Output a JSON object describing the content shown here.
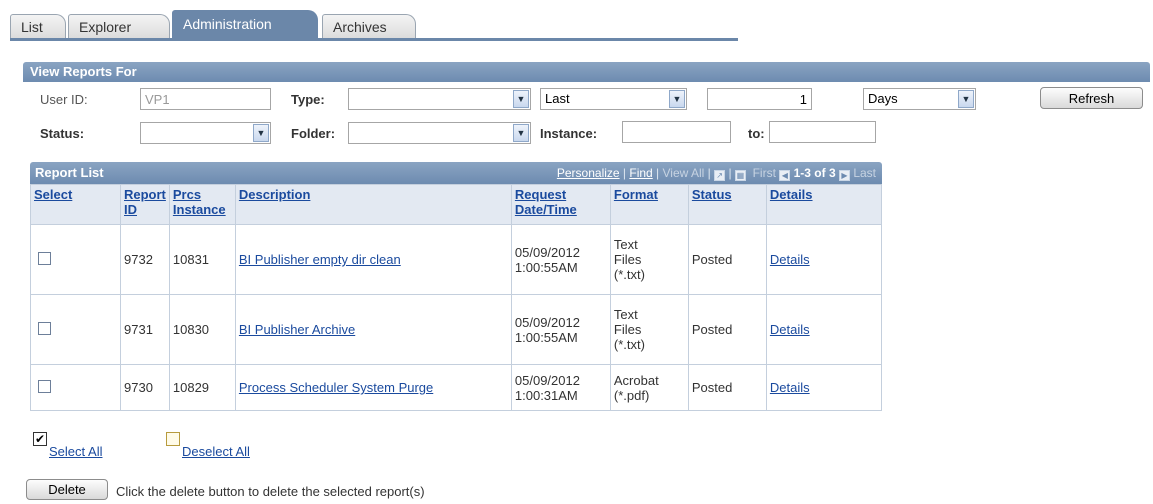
{
  "tabs": [
    "List",
    "Explorer",
    "Administration",
    "Archives"
  ],
  "view_reports": {
    "title": "View Reports For",
    "user_id_label": "User ID:",
    "user_id_value": "VP1",
    "type_label": "Type:",
    "type_value": "",
    "range_value": "Last",
    "range_count": "1",
    "range_unit": "Days",
    "refresh_label": "Refresh",
    "status_label": "Status:",
    "status_value": "",
    "folder_label": "Folder:",
    "folder_value": "",
    "instance_label": "Instance:",
    "instance_from": "",
    "to_label": "to:",
    "instance_to": ""
  },
  "report_list": {
    "title": "Report List",
    "personalize": "Personalize",
    "find": "Find",
    "view_all": "View All",
    "first": "First",
    "page_info": "1-3 of 3",
    "last": "Last",
    "columns": {
      "select": "Select",
      "report_id_1": "Report",
      "report_id_2": "ID",
      "prcs_1": "Prcs",
      "prcs_2": "Instance",
      "description": "Description",
      "request_1": "Request",
      "request_2": "Date/Time",
      "format": "Format",
      "status": "Status",
      "details": "Details"
    },
    "rows": [
      {
        "report_id": "9732",
        "instance": "10831",
        "description": "BI Publisher empty dir clean",
        "date": "05/09/2012",
        "time": "1:00:55AM",
        "format_1": "Text",
        "format_2": "Files",
        "format_3": "(*.txt)",
        "status": "Posted",
        "details": "Details"
      },
      {
        "report_id": "9731",
        "instance": "10830",
        "description": "BI Publisher Archive",
        "date": "05/09/2012",
        "time": "1:00:55AM",
        "format_1": "Text",
        "format_2": "Files",
        "format_3": "(*.txt)",
        "status": "Posted",
        "details": "Details"
      },
      {
        "report_id": "9730",
        "instance": "10829",
        "description": "Process Scheduler System Purge",
        "date": "05/09/2012",
        "time": "1:00:31AM",
        "format_1": "Acrobat",
        "format_2": "(*.pdf)",
        "format_3": "",
        "status": "Posted",
        "details": "Details"
      }
    ]
  },
  "select_all": "Select All",
  "deselect_all": "Deselect All",
  "delete_label": "Delete",
  "delete_message": "Click the delete button to delete the selected report(s)"
}
